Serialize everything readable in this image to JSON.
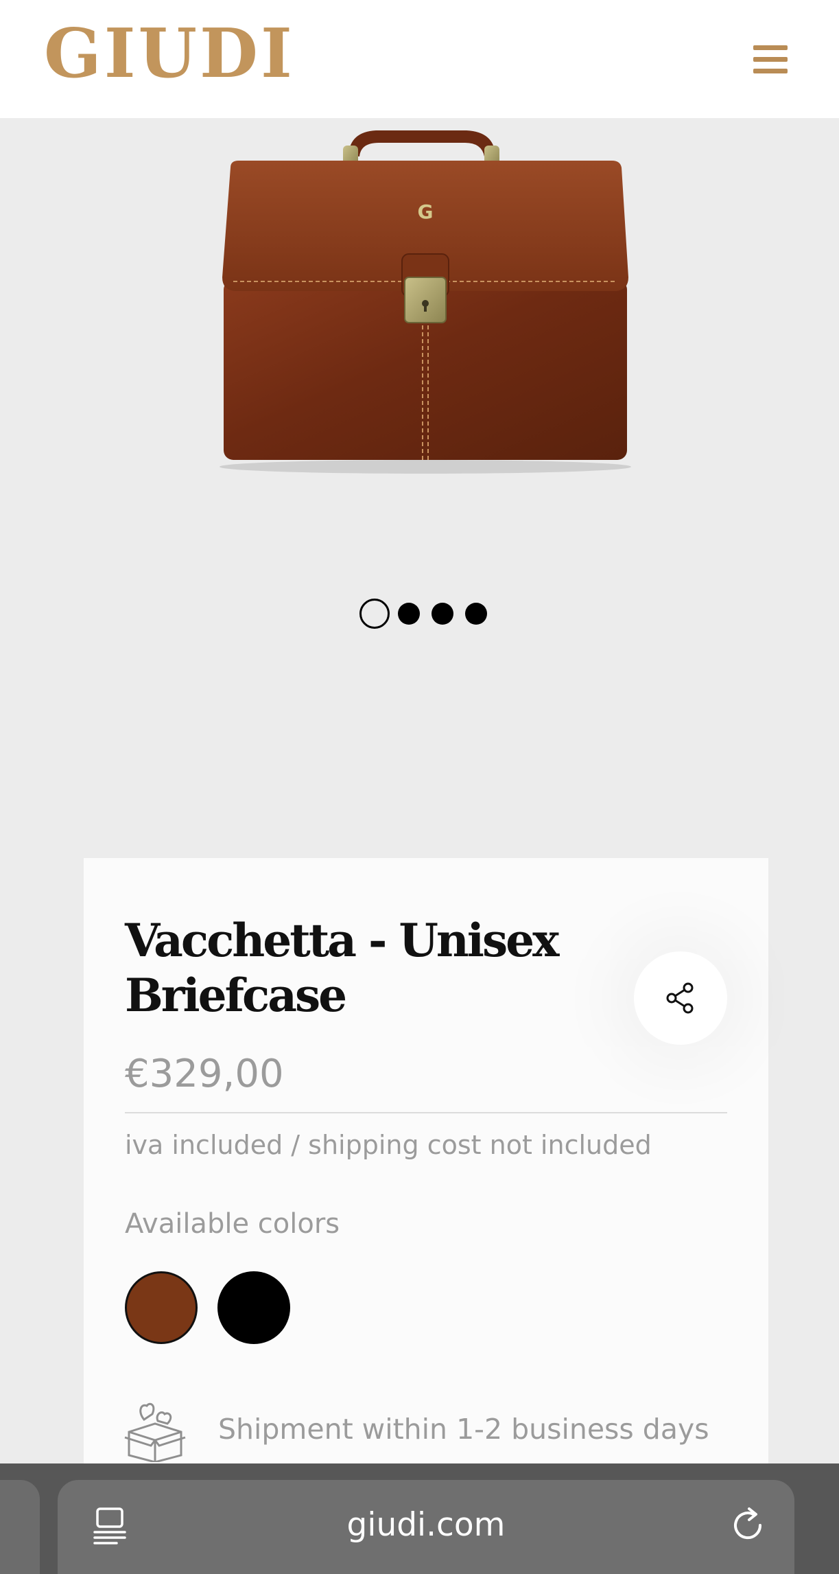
{
  "header": {
    "logo_text": "GIUDI",
    "menu_icon": "hamburger-menu-icon",
    "brand_color": "#c2955c"
  },
  "gallery": {
    "image_alt": "Vacchetta - Unisex Briefcase",
    "slide_count": 4,
    "active_slide": 1
  },
  "product": {
    "title": "Vacchetta - Unisex Briefcase",
    "price": "€329,00",
    "tax_note": "iva included / shipping cost not included",
    "colors_label": "Available colors",
    "colors": [
      {
        "name": "brown",
        "hex": "#7a3716",
        "selected": true
      },
      {
        "name": "black",
        "hex": "#000000",
        "selected": false
      }
    ],
    "share_icon": "share-icon",
    "shipping_icon": "gift-box-icon",
    "shipping_text": "Shipment within 1-2 business days"
  },
  "browser": {
    "url": "giudi.com",
    "tabs_icon": "tabs-icon",
    "reload_icon": "reload-icon"
  }
}
